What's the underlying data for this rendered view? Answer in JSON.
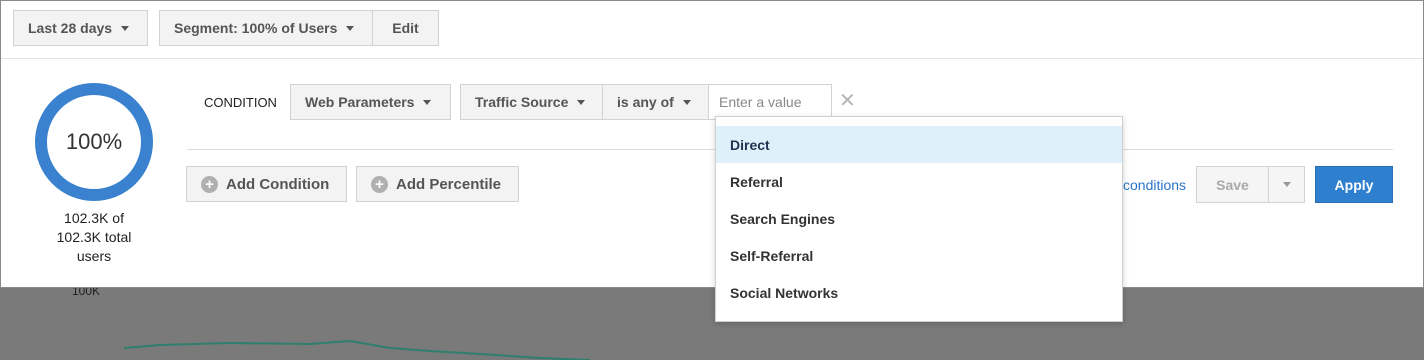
{
  "topbar": {
    "date_range": "Last 28 days",
    "segment": "Segment: 100% of Users",
    "edit": "Edit"
  },
  "summary": {
    "percent": "100%",
    "users_text_1": "102.3K of",
    "users_text_2": "102.3K total",
    "users_text_3": "users"
  },
  "condition": {
    "label": "CONDITION",
    "category": "Web Parameters",
    "field": "Traffic Source",
    "operator": "is any of",
    "value_placeholder": "Enter a value"
  },
  "actions": {
    "add_condition": "Add Condition",
    "add_percentile": "Add Percentile",
    "conditions_link": "conditions",
    "save": "Save",
    "apply": "Apply"
  },
  "dropdown": {
    "options": [
      "Direct",
      "Referral",
      "Search Engines",
      "Self-Referral",
      "Social Networks"
    ],
    "highlighted": "Direct"
  },
  "background_chart": {
    "axis_label": "100K",
    "line_color": "#2e7f6e"
  },
  "colors": {
    "accent": "#2f7fcf",
    "donut": "#3a82cf",
    "highlight": "#dff0fb"
  }
}
